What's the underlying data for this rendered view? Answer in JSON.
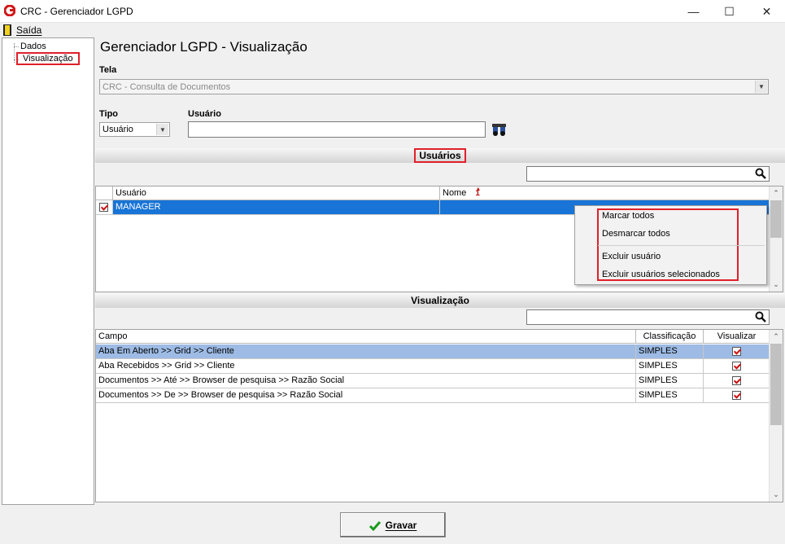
{
  "window": {
    "title": "CRC - Gerenciador LGPD",
    "controls": [
      "minimize",
      "maximize",
      "close"
    ]
  },
  "menu": {
    "exit_label": "Saída"
  },
  "tree": {
    "items": [
      "Dados",
      "Visualização"
    ],
    "selected": "Visualização"
  },
  "page_title": "Gerenciador LGPD - Visualização",
  "tela": {
    "label": "Tela",
    "value": "CRC - Consulta de Documentos"
  },
  "tipo": {
    "label": "Tipo",
    "value": "Usuário"
  },
  "usuario_field": {
    "label": "Usuário",
    "value": ""
  },
  "users_section": {
    "title": "Usuários",
    "search_value": "",
    "columns": [
      "Usuário",
      "Nome"
    ],
    "sort_indicator": "1",
    "rows": [
      {
        "checked": true,
        "usuario": "MANAGER",
        "nome": ""
      }
    ]
  },
  "context_menu": {
    "items": [
      "Marcar todos",
      "Desmarcar todos",
      "Excluir usuário",
      "Excluir usuários selecionados"
    ]
  },
  "view_section": {
    "title": "Visualização",
    "search_value": "",
    "columns": [
      "Campo",
      "Classificação",
      "Visualizar"
    ],
    "rows": [
      {
        "campo": "Aba Em Aberto >> Grid >>  Cliente",
        "classificacao": "SIMPLES",
        "visualizar": true
      },
      {
        "campo": "Aba Recebidos >> Grid >> Cliente",
        "classificacao": "SIMPLES",
        "visualizar": true
      },
      {
        "campo": "Documentos >> Até >> Browser de pesquisa >> Razão Social",
        "classificacao": "SIMPLES",
        "visualizar": true
      },
      {
        "campo": "Documentos >> De >> Browser de pesquisa >> Razão Social",
        "classificacao": "SIMPLES",
        "visualizar": true
      }
    ]
  },
  "save_button": {
    "label": "Gravar"
  },
  "colors": {
    "highlight_red": "#e0202a",
    "selection_blue": "#1874d6",
    "row_highlight": "#9dbbe4"
  }
}
